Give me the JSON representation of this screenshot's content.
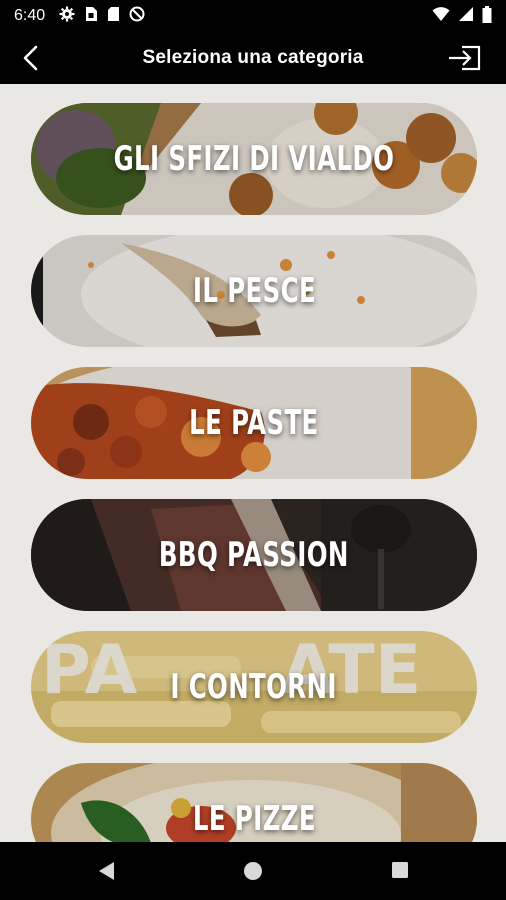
{
  "status_bar": {
    "time": "6:40",
    "left_icons": [
      "gear-icon",
      "sim-icon",
      "sd-card-icon",
      "do-not-disturb-icon"
    ],
    "right_icons": [
      "wifi-icon",
      "signal-icon",
      "battery-icon"
    ]
  },
  "app_bar": {
    "title": "Seleziona una categoria",
    "back_icon": "chevron-left-icon",
    "logout_icon": "logout-icon"
  },
  "categories": [
    {
      "label": "GLI SFIZI DI VIALDO",
      "theme": "fried-appetizers"
    },
    {
      "label": "IL PESCE",
      "theme": "fish-plate"
    },
    {
      "label": "LE PASTE",
      "theme": "pasta"
    },
    {
      "label": "BBQ PASSION",
      "theme": "bbq-meat"
    },
    {
      "label": "I CONTORNI",
      "theme": "fries"
    },
    {
      "label": "LE PIZZE",
      "theme": "pizza"
    }
  ],
  "nav_bar": {
    "back": "triangle-back-icon",
    "home": "circle-home-icon",
    "recents": "square-recents-icon"
  }
}
